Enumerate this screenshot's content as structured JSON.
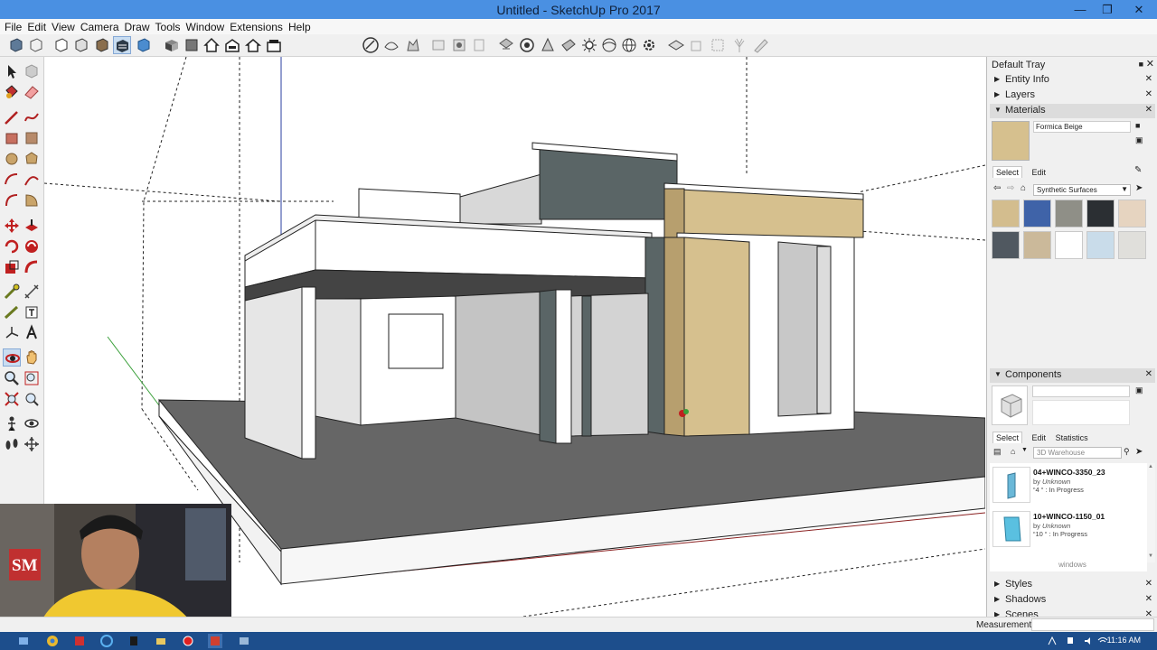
{
  "window": {
    "title": "Untitled - SketchUp Pro 2017",
    "controls": [
      "minimize-icon",
      "maximize-icon",
      "close-icon"
    ]
  },
  "menu": [
    "File",
    "Edit",
    "View",
    "Camera",
    "Draw",
    "Tools",
    "Window",
    "Extensions",
    "Help"
  ],
  "tray": {
    "title": "Default Tray",
    "sections": {
      "entity_info": "Entity Info",
      "layers": "Layers",
      "materials": "Materials",
      "components": "Components",
      "styles": "Styles",
      "shadows": "Shadows",
      "scenes": "Scenes"
    },
    "materials": {
      "current_name": "Formica Beige",
      "tab_select": "Select",
      "tab_edit": "Edit",
      "library": "Synthetic Surfaces",
      "swatch_colors": [
        "#d3bd8e",
        "#3f63a8",
        "#8f8f87",
        "#2b2f33",
        "#e6d4c0",
        "#505860",
        "#cbb99a",
        "#ffffff",
        "#c9dcea",
        "#e0dfdb"
      ]
    },
    "components": {
      "tab_select": "Select",
      "tab_edit": "Edit",
      "tab_statistics": "Statistics",
      "search_placeholder": "3D Warehouse",
      "items": [
        {
          "name": "04+WINCO-3350_23",
          "by": "by",
          "author": "Unknown",
          "status_count": "4",
          "status": "In Progress"
        },
        {
          "name": "10+WINCO-1150_01",
          "by": "by",
          "author": "Unknown",
          "status_count": "10",
          "status": "In Progress"
        }
      ],
      "footer": "windows"
    }
  },
  "status": {
    "measurements_label": "Measurements",
    "measurements_value": ""
  },
  "taskbar": {
    "clock": "11:16 AM"
  },
  "webcam": {
    "logo_text": "SM"
  }
}
